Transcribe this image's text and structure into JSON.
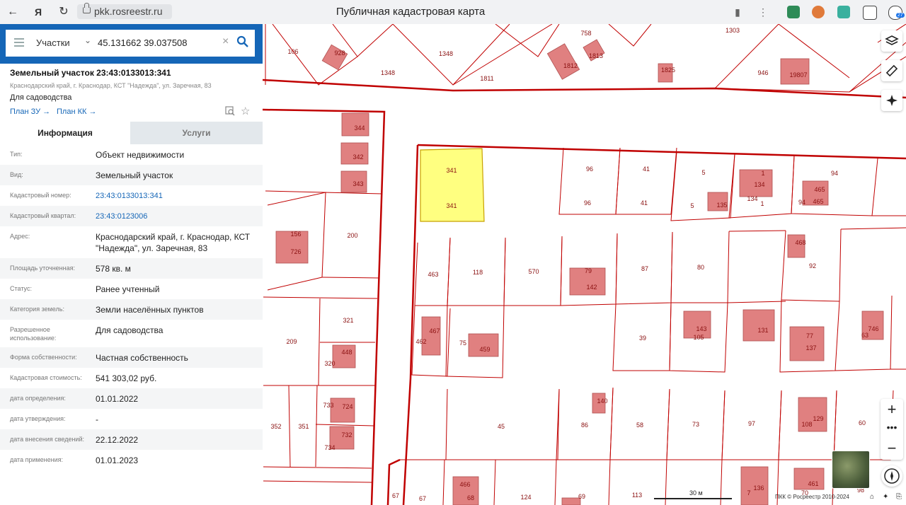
{
  "browser": {
    "url": "pkk.rosreestr.ru",
    "page_title": "Публичная кадастровая карта",
    "extension_badge": "27"
  },
  "search": {
    "type_label": "Участки",
    "query": "45.131662 39.037508"
  },
  "parcel": {
    "title": "Земельный участок 23:43:0133013:341",
    "address_short": "Краснодарский край, г. Краснодар, КСТ \"Надежда\", ул. Заречная, 83",
    "usage": "Для садоводства",
    "plan_zu": "План ЗУ →",
    "plan_kk": "План КК →"
  },
  "tabs": {
    "info": "Информация",
    "services": "Услуги"
  },
  "rows": [
    {
      "label": "Тип:",
      "value": "Объект недвижимости"
    },
    {
      "label": "Вид:",
      "value": "Земельный участок"
    },
    {
      "label": "Кадастровый номер:",
      "value": "23:43:0133013:341"
    },
    {
      "label": "Кадастровый квартал:",
      "value": "23:43:0123006"
    },
    {
      "label": "Адрес:",
      "value": "Краснодарский край, г. Краснодар, КСТ \"Надежда\", ул. Заречная, 83"
    },
    {
      "label": "Площадь уточненная:",
      "value": "578 кв. м"
    },
    {
      "label": "Статус:",
      "value": "Ранее учтенный"
    },
    {
      "label": "Категория земель:",
      "value": "Земли населённых пунктов"
    },
    {
      "label": "Разрешенное использование:",
      "value": "Для садоводства"
    },
    {
      "label": "Форма собственности:",
      "value": "Частная собственность"
    },
    {
      "label": "Кадастровая стоимость:",
      "value": "541 303,02 руб."
    },
    {
      "label": "дата определения:",
      "value": "01.01.2022"
    },
    {
      "label": "дата утверждения:",
      "value": "-"
    },
    {
      "label": "дата внесения сведений:",
      "value": "22.12.2022"
    },
    {
      "label": "дата применения:",
      "value": "01.01.2023"
    }
  ],
  "map": {
    "scale_label": "30 м",
    "copyright": "ПКК © Росреестр 2010-2024",
    "parcel_labels": [
      "106",
      "928",
      "1348",
      "1348",
      "758",
      "1813",
      "1812",
      "1811",
      "1825",
      "1303",
      "946",
      "19807",
      "344",
      "342",
      "343",
      "341",
      "341",
      "96",
      "96",
      "41",
      "41",
      "5",
      "5",
      "135",
      "1",
      "134",
      "134",
      "1",
      "94",
      "94",
      "465",
      "465",
      "156",
      "726",
      "200",
      "463",
      "118",
      "570",
      "79",
      "142",
      "87",
      "80",
      "468",
      "92",
      "209",
      "321",
      "320",
      "448",
      "462",
      "467",
      "75",
      "459",
      "39",
      "143",
      "105",
      "131",
      "77",
      "137",
      "63",
      "746",
      "733",
      "734",
      "734",
      "732",
      "352",
      "351",
      "45",
      "86",
      "58",
      "73",
      "97",
      "129",
      "108",
      "60",
      "140",
      "67",
      "68",
      "466",
      "124",
      "69",
      "113",
      "7",
      "136",
      "70",
      "461",
      "98"
    ],
    "selected_parcel_color": "#ffff80",
    "building_color": "#e08080",
    "boundary_color": "#c00000"
  }
}
